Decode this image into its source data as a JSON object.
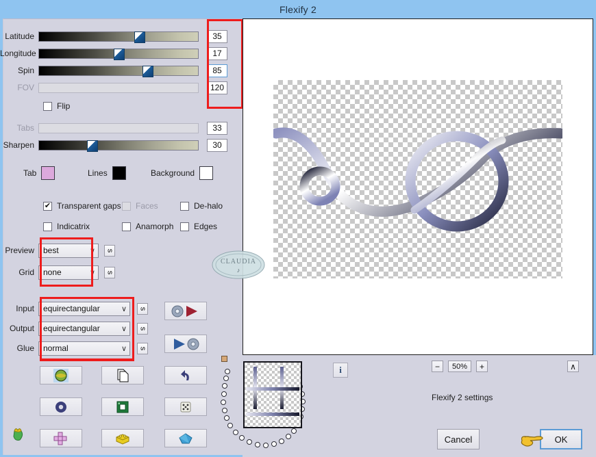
{
  "window": {
    "title": "Flexify 2"
  },
  "sliders": [
    {
      "label": "Latitude",
      "value": "35",
      "pct": 68,
      "disabled": false,
      "focused": false
    },
    {
      "label": "Longitude",
      "value": "17",
      "pct": 55,
      "disabled": false,
      "focused": false
    },
    {
      "label": "Spin",
      "value": "85",
      "pct": 73,
      "disabled": false,
      "focused": true
    },
    {
      "label": "FOV",
      "value": "120",
      "pct": 0,
      "disabled": true,
      "focused": false
    }
  ],
  "flip": {
    "label": "Flip",
    "checked": false
  },
  "sliders2": [
    {
      "label": "Tabs",
      "value": "33",
      "pct": 0,
      "disabled": true,
      "focused": false
    },
    {
      "label": "Sharpen",
      "value": "30",
      "pct": 37,
      "disabled": false,
      "focused": false
    }
  ],
  "colors": [
    {
      "label": "Tab",
      "hex": "#dca9dc",
      "name": "tab-color-swatch"
    },
    {
      "label": "Lines",
      "hex": "#000000",
      "name": "lines-color-swatch"
    },
    {
      "label": "Background",
      "hex": "#ffffff",
      "name": "background-color-swatch"
    }
  ],
  "checkboxes": [
    {
      "label": "Transparent gaps",
      "checked": true,
      "disabled": false,
      "mark": "✔"
    },
    {
      "label": "Faces",
      "checked": false,
      "disabled": true,
      "mark": ""
    },
    {
      "label": "De-halo",
      "checked": false,
      "disabled": false,
      "mark": ""
    },
    {
      "label": "Indicatrix",
      "checked": false,
      "disabled": false,
      "mark": ""
    },
    {
      "label": "Anamorph",
      "checked": false,
      "disabled": false,
      "mark": ""
    },
    {
      "label": "Edges",
      "checked": false,
      "disabled": false,
      "mark": ""
    }
  ],
  "selects": [
    {
      "label": "Preview",
      "value": "best",
      "chev": "∨",
      "sbtn": "s"
    },
    {
      "label": "Grid",
      "value": "none",
      "chev": "∨",
      "sbtn": "s"
    },
    {
      "label": "Input",
      "value": "equirectangular",
      "chev": "∨",
      "sbtn": "s"
    },
    {
      "label": "Output",
      "value": "equirectangular",
      "chev": "∨",
      "sbtn": "s"
    },
    {
      "label": "Glue",
      "value": "normal",
      "chev": "∨",
      "sbtn": "s"
    }
  ],
  "io_buttons": [
    {
      "name": "load-settings-button"
    },
    {
      "name": "save-settings-button"
    }
  ],
  "tool_buttons": [
    {
      "name": "tool-globe-button"
    },
    {
      "name": "tool-copy-button"
    },
    {
      "name": "tool-undo-button"
    },
    {
      "name": "tool-ring-button"
    },
    {
      "name": "tool-frame-button"
    },
    {
      "name": "tool-dice-button"
    },
    {
      "name": "tool-cross-button"
    },
    {
      "name": "tool-brick-button"
    },
    {
      "name": "tool-gem-button"
    }
  ],
  "preview": {
    "watermark": "CLAUDIA",
    "info_button": "i"
  },
  "zoom": {
    "minus": "−",
    "value": "50%",
    "plus": "+",
    "collapse": "∧"
  },
  "footer": {
    "status": "Flexify 2 settings",
    "cancel": "Cancel",
    "ok": "OK"
  },
  "accent": {
    "annotation_red": "#ee1c1c",
    "titlebar_blue": "#8fc4f0",
    "panel": "#d3d3e0",
    "focus_blue": "#5b9bd5"
  }
}
